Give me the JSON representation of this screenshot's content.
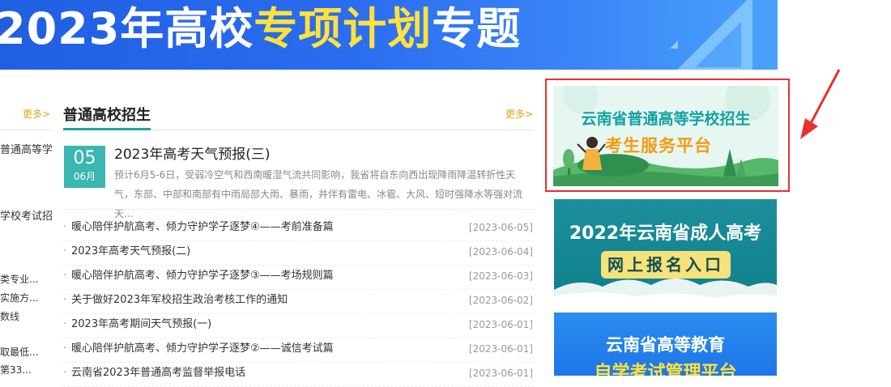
{
  "banner": {
    "title_pre": "2023年高校",
    "title_highlight": "专项计划",
    "title_post": "专题"
  },
  "left": {
    "more": "更多>",
    "items": [
      "普通高等学",
      "学校考试招"
    ],
    "small_items": [
      "类专业...",
      "实施方...",
      "数线",
      "取最低...",
      "第33..."
    ]
  },
  "news": {
    "section_title": "普通高校招生",
    "more": "更多>",
    "featured": {
      "day": "05",
      "month": "06月",
      "title": "2023年高考天气预报(三)",
      "desc": "预计6月5-6日，受弱冷空气和西南暖湿气流共同影响，我省将自东向西出现降雨降温转折性天气，东部、中部和南部有中雨局部大雨、暴雨，并伴有雷电、冰雹、大风、短时强降水等强对流天..."
    },
    "items": [
      {
        "title": "暖心陪伴护航高考、倾力守护学子逐梦④——考前准备篇",
        "date": "[2023-06-05]"
      },
      {
        "title": "2023年高考天气预报(二)",
        "date": "[2023-06-04]"
      },
      {
        "title": "暖心陪伴护航高考、倾力守护学子逐梦③——考场规则篇",
        "date": "[2023-06-03]"
      },
      {
        "title": "关于做好2023年军校招生政治考核工作的通知",
        "date": "[2023-06-02]"
      },
      {
        "title": "2023年高考期间天气预报(一)",
        "date": "[2023-06-01]"
      },
      {
        "title": "暖心陪伴护航高考、倾力守护学子逐梦②——诚信考试篇",
        "date": "[2023-06-01]"
      },
      {
        "title": "云南省2023年普通高考监督举报电话",
        "date": "[2023-06-01]"
      }
    ]
  },
  "banners": {
    "b1_line1": "云南省普通高等学校招生",
    "b1_line2": "考生服务平台",
    "b2_line1": "2022年云南省成人高考",
    "b2_line2": "网上报名入口",
    "b3_line1": "云南省高等教育",
    "b3_line2": "自学考试管理平台"
  },
  "colors": {
    "teal": "#1ba4a2",
    "gold": "#e0a21b",
    "red": "#e8322b",
    "banner_blue": "#2b6cf0"
  }
}
